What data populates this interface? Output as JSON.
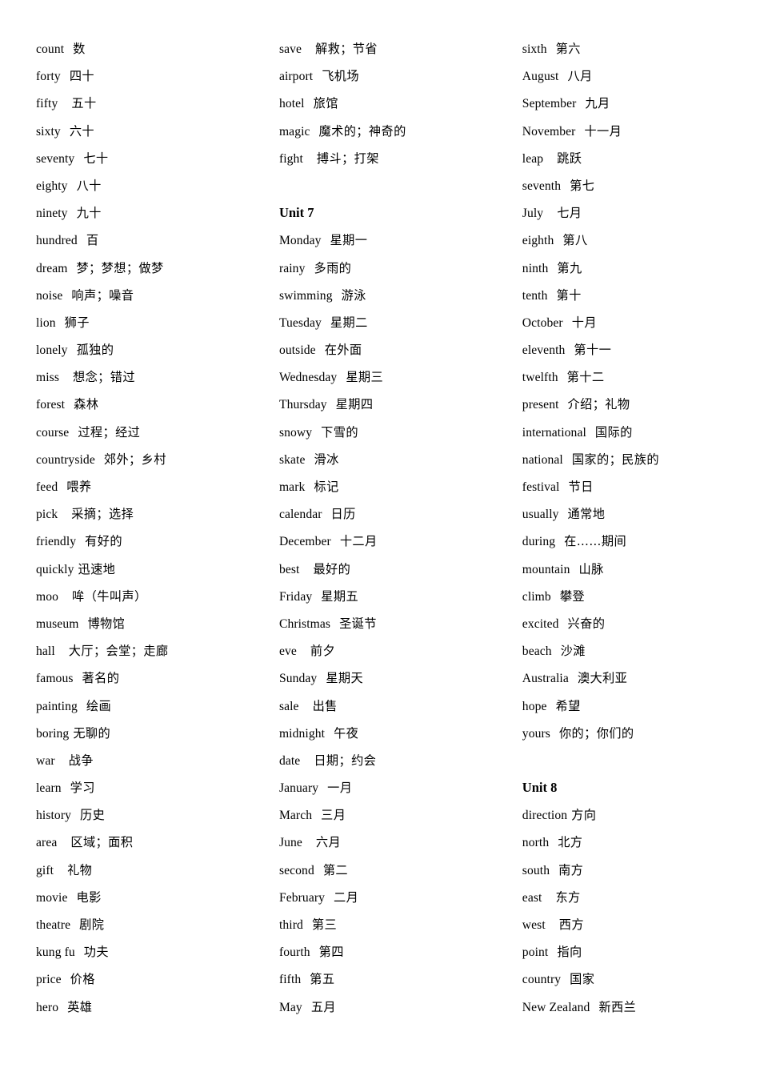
{
  "document": {
    "type": "vocabulary-glossary",
    "language_pair": "English-Chinese",
    "column_count": 3,
    "text_color": "#000000",
    "background_color": "#ffffff"
  },
  "columns": [
    {
      "id": "column-1",
      "blocks": [
        {
          "type": "entries",
          "entries": [
            {
              "en": "count",
              "gap": 2,
              "zh": "数"
            },
            {
              "en": "forty",
              "gap": 2,
              "zh": "四十"
            },
            {
              "en": "fifty",
              "gap": 3,
              "zh": "五十"
            },
            {
              "en": "sixty",
              "gap": 2,
              "zh": "六十"
            },
            {
              "en": "seventy",
              "gap": 2,
              "zh": "七十"
            },
            {
              "en": "eighty",
              "gap": 2,
              "zh": "八十"
            },
            {
              "en": "ninety",
              "gap": 2,
              "zh": "九十"
            },
            {
              "en": "hundred",
              "gap": 2,
              "zh": "百"
            },
            {
              "en": "dream",
              "gap": 2,
              "zh": "梦；梦想；做梦"
            },
            {
              "en": "noise",
              "gap": 2,
              "zh": "响声；噪音"
            },
            {
              "en": "lion",
              "gap": 2,
              "zh": "狮子"
            },
            {
              "en": "lonely",
              "gap": 2,
              "zh": "孤独的"
            },
            {
              "en": "miss",
              "gap": 3,
              "zh": "想念；错过"
            },
            {
              "en": "forest",
              "gap": 2,
              "zh": "森林"
            },
            {
              "en": "course",
              "gap": 2,
              "zh": "过程；经过"
            },
            {
              "en": "countryside",
              "gap": 2,
              "zh": "郊外；乡村"
            },
            {
              "en": "feed",
              "gap": 2,
              "zh": "喂养"
            },
            {
              "en": "pick",
              "gap": 3,
              "zh": "采摘；选择"
            },
            {
              "en": "friendly",
              "gap": 2,
              "zh": "有好的"
            },
            {
              "en": "quickly",
              "gap": 1,
              "zh": "迅速地"
            },
            {
              "en": "moo",
              "gap": 3,
              "zh": "哞（牛叫声）"
            },
            {
              "en": "museum",
              "gap": 2,
              "zh": "博物馆"
            },
            {
              "en": "hall",
              "gap": 3,
              "zh": "大厅；会堂；走廊"
            },
            {
              "en": "famous",
              "gap": 2,
              "zh": "著名的"
            },
            {
              "en": "painting",
              "gap": 2,
              "zh": "绘画"
            },
            {
              "en": "boring",
              "gap": 1,
              "zh": "无聊的"
            },
            {
              "en": "war",
              "gap": 3,
              "zh": "战争"
            },
            {
              "en": "learn",
              "gap": 2,
              "zh": "学习"
            },
            {
              "en": "history",
              "gap": 2,
              "zh": "历史"
            },
            {
              "en": "area",
              "gap": 3,
              "zh": "区域；面积"
            },
            {
              "en": "gift",
              "gap": 3,
              "zh": "礼物"
            },
            {
              "en": "movie",
              "gap": 2,
              "zh": "电影"
            },
            {
              "en": "theatre",
              "gap": 2,
              "zh": "剧院"
            },
            {
              "en": "kung fu",
              "gap": 2,
              "zh": "功夫"
            },
            {
              "en": "price",
              "gap": 2,
              "zh": "价格"
            },
            {
              "en": "hero",
              "gap": 2,
              "zh": "英雄"
            }
          ]
        }
      ]
    },
    {
      "id": "column-2",
      "blocks": [
        {
          "type": "entries",
          "entries": [
            {
              "en": "save",
              "gap": 3,
              "zh": "解救；节省"
            },
            {
              "en": "airport",
              "gap": 2,
              "zh": "飞机场"
            },
            {
              "en": "hotel",
              "gap": 2,
              "zh": "旅馆"
            },
            {
              "en": "magic",
              "gap": 2,
              "zh": "魔术的；神奇的"
            },
            {
              "en": "fight",
              "gap": 3,
              "zh": "搏斗；打架"
            }
          ]
        },
        {
          "type": "spacer"
        },
        {
          "type": "heading",
          "label": "Unit 7"
        },
        {
          "type": "entries",
          "entries": [
            {
              "en": "Monday",
              "gap": 2,
              "zh": "星期一"
            },
            {
              "en": "rainy",
              "gap": 2,
              "zh": "多雨的"
            },
            {
              "en": "swimming",
              "gap": 2,
              "zh": "游泳"
            },
            {
              "en": "Tuesday",
              "gap": 2,
              "zh": "星期二"
            },
            {
              "en": "outside",
              "gap": 2,
              "zh": "在外面"
            },
            {
              "en": "Wednesday",
              "gap": 2,
              "zh": "星期三"
            },
            {
              "en": "Thursday",
              "gap": 2,
              "zh": "星期四"
            },
            {
              "en": "snowy",
              "gap": 2,
              "zh": "下雪的"
            },
            {
              "en": "skate",
              "gap": 2,
              "zh": "滑冰"
            },
            {
              "en": "mark",
              "gap": 2,
              "zh": "标记"
            },
            {
              "en": "calendar",
              "gap": 2,
              "zh": "日历"
            },
            {
              "en": "December",
              "gap": 2,
              "zh": "十二月"
            },
            {
              "en": "best",
              "gap": 3,
              "zh": "最好的"
            },
            {
              "en": "Friday",
              "gap": 2,
              "zh": "星期五"
            },
            {
              "en": "Christmas",
              "gap": 2,
              "zh": "圣诞节"
            },
            {
              "en": "eve",
              "gap": 3,
              "zh": "前夕"
            },
            {
              "en": "Sunday",
              "gap": 2,
              "zh": "星期天"
            },
            {
              "en": "sale",
              "gap": 3,
              "zh": "出售"
            },
            {
              "en": "midnight",
              "gap": 2,
              "zh": "午夜"
            },
            {
              "en": "date",
              "gap": 3,
              "zh": "日期；约会"
            },
            {
              "en": "January",
              "gap": 2,
              "zh": "一月"
            },
            {
              "en": "March",
              "gap": 2,
              "zh": "三月"
            },
            {
              "en": "June",
              "gap": 3,
              "zh": "六月"
            },
            {
              "en": "second",
              "gap": 2,
              "zh": "第二"
            },
            {
              "en": "February",
              "gap": 2,
              "zh": "二月"
            },
            {
              "en": "third",
              "gap": 2,
              "zh": "第三"
            },
            {
              "en": "fourth",
              "gap": 2,
              "zh": "第四"
            },
            {
              "en": "fifth",
              "gap": 2,
              "zh": "第五"
            },
            {
              "en": "May",
              "gap": 2,
              "zh": "五月"
            }
          ]
        }
      ]
    },
    {
      "id": "column-3",
      "blocks": [
        {
          "type": "entries",
          "entries": [
            {
              "en": "sixth",
              "gap": 2,
              "zh": "第六"
            },
            {
              "en": "August",
              "gap": 2,
              "zh": "八月"
            },
            {
              "en": "September",
              "gap": 2,
              "zh": "九月"
            },
            {
              "en": "November",
              "gap": 2,
              "zh": "十一月"
            },
            {
              "en": "leap",
              "gap": 3,
              "zh": "跳跃"
            },
            {
              "en": "seventh",
              "gap": 2,
              "zh": "第七"
            },
            {
              "en": "July",
              "gap": 3,
              "zh": "七月"
            },
            {
              "en": "eighth",
              "gap": 2,
              "zh": "第八"
            },
            {
              "en": "ninth",
              "gap": 2,
              "zh": "第九"
            },
            {
              "en": "tenth",
              "gap": 2,
              "zh": "第十"
            },
            {
              "en": "October",
              "gap": 2,
              "zh": "十月"
            },
            {
              "en": "eleventh",
              "gap": 2,
              "zh": "第十一"
            },
            {
              "en": "twelfth",
              "gap": 2,
              "zh": "第十二"
            },
            {
              "en": "present",
              "gap": 2,
              "zh": "介绍；礼物"
            },
            {
              "en": "international",
              "gap": 2,
              "zh": "国际的"
            },
            {
              "en": "national",
              "gap": 2,
              "zh": "国家的；民族的"
            },
            {
              "en": "festival",
              "gap": 2,
              "zh": "节日"
            },
            {
              "en": "usually",
              "gap": 2,
              "zh": "通常地"
            },
            {
              "en": "during",
              "gap": 2,
              "zh": "在……期间"
            },
            {
              "en": "mountain",
              "gap": 2,
              "zh": "山脉"
            },
            {
              "en": "climb",
              "gap": 2,
              "zh": "攀登"
            },
            {
              "en": "excited",
              "gap": 2,
              "zh": "兴奋的"
            },
            {
              "en": "beach",
              "gap": 2,
              "zh": "沙滩"
            },
            {
              "en": "Australia",
              "gap": 2,
              "zh": "澳大利亚"
            },
            {
              "en": "hope",
              "gap": 2,
              "zh": "希望"
            },
            {
              "en": "yours",
              "gap": 2,
              "zh": "你的；你们的"
            }
          ]
        },
        {
          "type": "spacer"
        },
        {
          "type": "heading",
          "label": "Unit 8"
        },
        {
          "type": "entries",
          "entries": [
            {
              "en": "direction",
              "gap": 1,
              "zh": "方向"
            },
            {
              "en": "north",
              "gap": 2,
              "zh": "北方"
            },
            {
              "en": "south",
              "gap": 2,
              "zh": "南方"
            },
            {
              "en": "east",
              "gap": 3,
              "zh": "东方"
            },
            {
              "en": "west",
              "gap": 3,
              "zh": "西方"
            },
            {
              "en": "point",
              "gap": 2,
              "zh": "指向"
            },
            {
              "en": "country",
              "gap": 2,
              "zh": "国家"
            },
            {
              "en": "New Zealand",
              "gap": 2,
              "zh": "新西兰"
            }
          ]
        }
      ]
    }
  ]
}
